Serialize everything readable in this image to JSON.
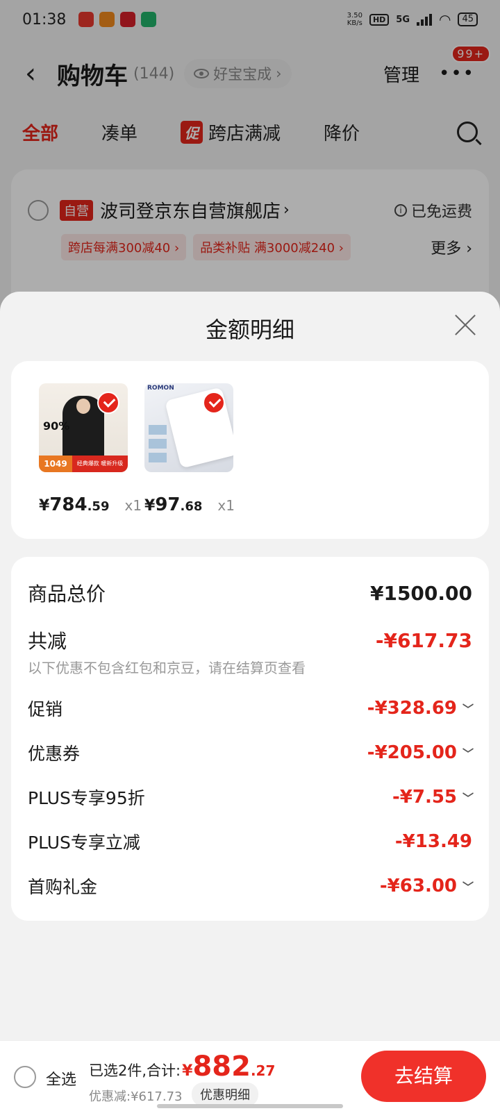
{
  "status_bar": {
    "time": "01:38",
    "net_speed_value": "3.50",
    "net_speed_unit": "KB/s",
    "hd": "HD",
    "network": "5G",
    "battery": "45"
  },
  "header": {
    "title": "购物车",
    "count": "(144)",
    "tag_label": "好宝宝成",
    "tag_arrow": "›",
    "manage_label": "管理",
    "more_badge": "99+"
  },
  "tabs": [
    {
      "label": "全部",
      "active": true
    },
    {
      "label": "凑单"
    },
    {
      "label": "跨店满减",
      "chip": "促"
    },
    {
      "label": "降价"
    }
  ],
  "store": {
    "badge": "自营",
    "name": "波司登京东自营旗舰店",
    "arrow": "›",
    "shipping": "已免运费",
    "promos": [
      "跨店每满300减40 ›",
      "品类补贴 满3000减240 ›"
    ],
    "more": "更多 ›"
  },
  "sheet": {
    "title": "金额明细",
    "products": [
      {
        "yen": "¥",
        "price_int": "784",
        "price_dec": ".59",
        "qty": "x1",
        "image_text": "90%",
        "image_price": "1049",
        "image_strip": "经典爆款 暖新升级",
        "checked": true
      },
      {
        "yen": "¥",
        "price_int": "97",
        "price_dec": ".68",
        "qty": "x1",
        "image_brand": "ROMON",
        "checked": true
      }
    ],
    "rows": {
      "total_label": "商品总价",
      "total_value": "¥1500.00",
      "reduce_label": "共减",
      "reduce_value": "-¥617.73",
      "reduce_hint": "以下优惠不包含红包和京豆，请在结算页查看",
      "promo_label": "促销",
      "promo_value": "-¥328.69",
      "coupon_label": "优惠券",
      "coupon_value": "-¥205.00",
      "plus95_label": "PLUS专享95折",
      "plus95_value": "-¥7.55",
      "plusdirect_label": "PLUS专享立减",
      "plusdirect_value": "-¥13.49",
      "firstbuy_label": "首购礼金",
      "firstbuy_value": "-¥63.00"
    }
  },
  "checkout": {
    "select_all": "全选",
    "summary_label": "已选2件,合计:",
    "yen": "¥",
    "total_int": "882",
    "total_dec": ".27",
    "discount": "优惠减:¥617.73",
    "detail_chip": "优惠明细",
    "button": "去结算"
  },
  "colors": {
    "accent": "#e4251b",
    "button": "#f0312a"
  }
}
